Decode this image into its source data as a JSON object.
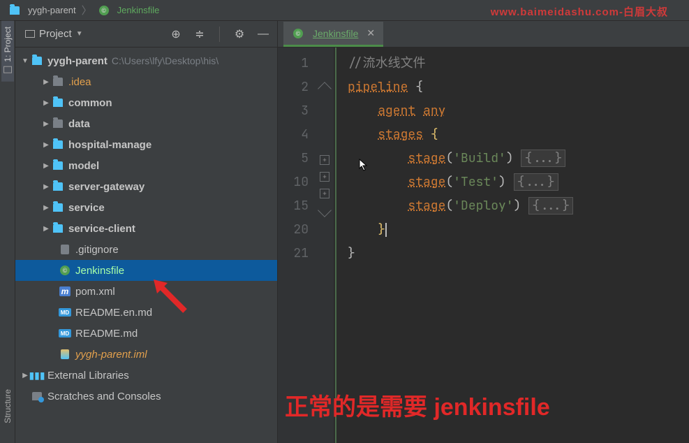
{
  "breadcrumb": {
    "root": "yygh-parent",
    "file": "Jenkinsfile"
  },
  "watermark": "www.baimeidashu.com-白眉大叔",
  "sidebar": {
    "title": "Project",
    "tools": {
      "target": "⊕",
      "expand": "≑",
      "gear": "⚙",
      "minimize": "—"
    },
    "root": {
      "label": "yygh-parent",
      "path": "C:\\Users\\lfy\\Desktop\\his\\"
    },
    "items": [
      {
        "label": ".idea",
        "type": "folder-orange"
      },
      {
        "label": "common",
        "type": "folder"
      },
      {
        "label": "data",
        "type": "folder"
      },
      {
        "label": "hospital-manage",
        "type": "folder"
      },
      {
        "label": "model",
        "type": "folder"
      },
      {
        "label": "server-gateway",
        "type": "folder"
      },
      {
        "label": "service",
        "type": "folder"
      },
      {
        "label": "service-client",
        "type": "folder"
      },
      {
        "label": ".gitignore",
        "type": "file"
      },
      {
        "label": "Jenkinsfile",
        "type": "jenkins",
        "selected": true
      },
      {
        "label": "pom.xml",
        "type": "pom"
      },
      {
        "label": "README.en.md",
        "type": "md"
      },
      {
        "label": "README.md",
        "type": "md"
      },
      {
        "label": "yygh-parent.iml",
        "type": "iml"
      }
    ],
    "external": "External Libraries",
    "scratches": "Scratches and Consoles"
  },
  "rail": {
    "project_tab": "1: Project",
    "structure_tab": "Structure"
  },
  "tabs": [
    {
      "label": "Jenkinsfile"
    }
  ],
  "code": {
    "line_numbers": [
      "1",
      "2",
      "3",
      "4",
      "5",
      "10",
      "15",
      "20",
      "21"
    ],
    "comment": "//流水线文件",
    "pipeline": "pipeline",
    "agent": "agent",
    "any": "any",
    "stages": "stages",
    "stage": "stage",
    "build": "'Build'",
    "test": "'Test'",
    "deploy": "'Deploy'",
    "fold": "{...}"
  },
  "annotation": "正常的是需要 jenkinsfile"
}
